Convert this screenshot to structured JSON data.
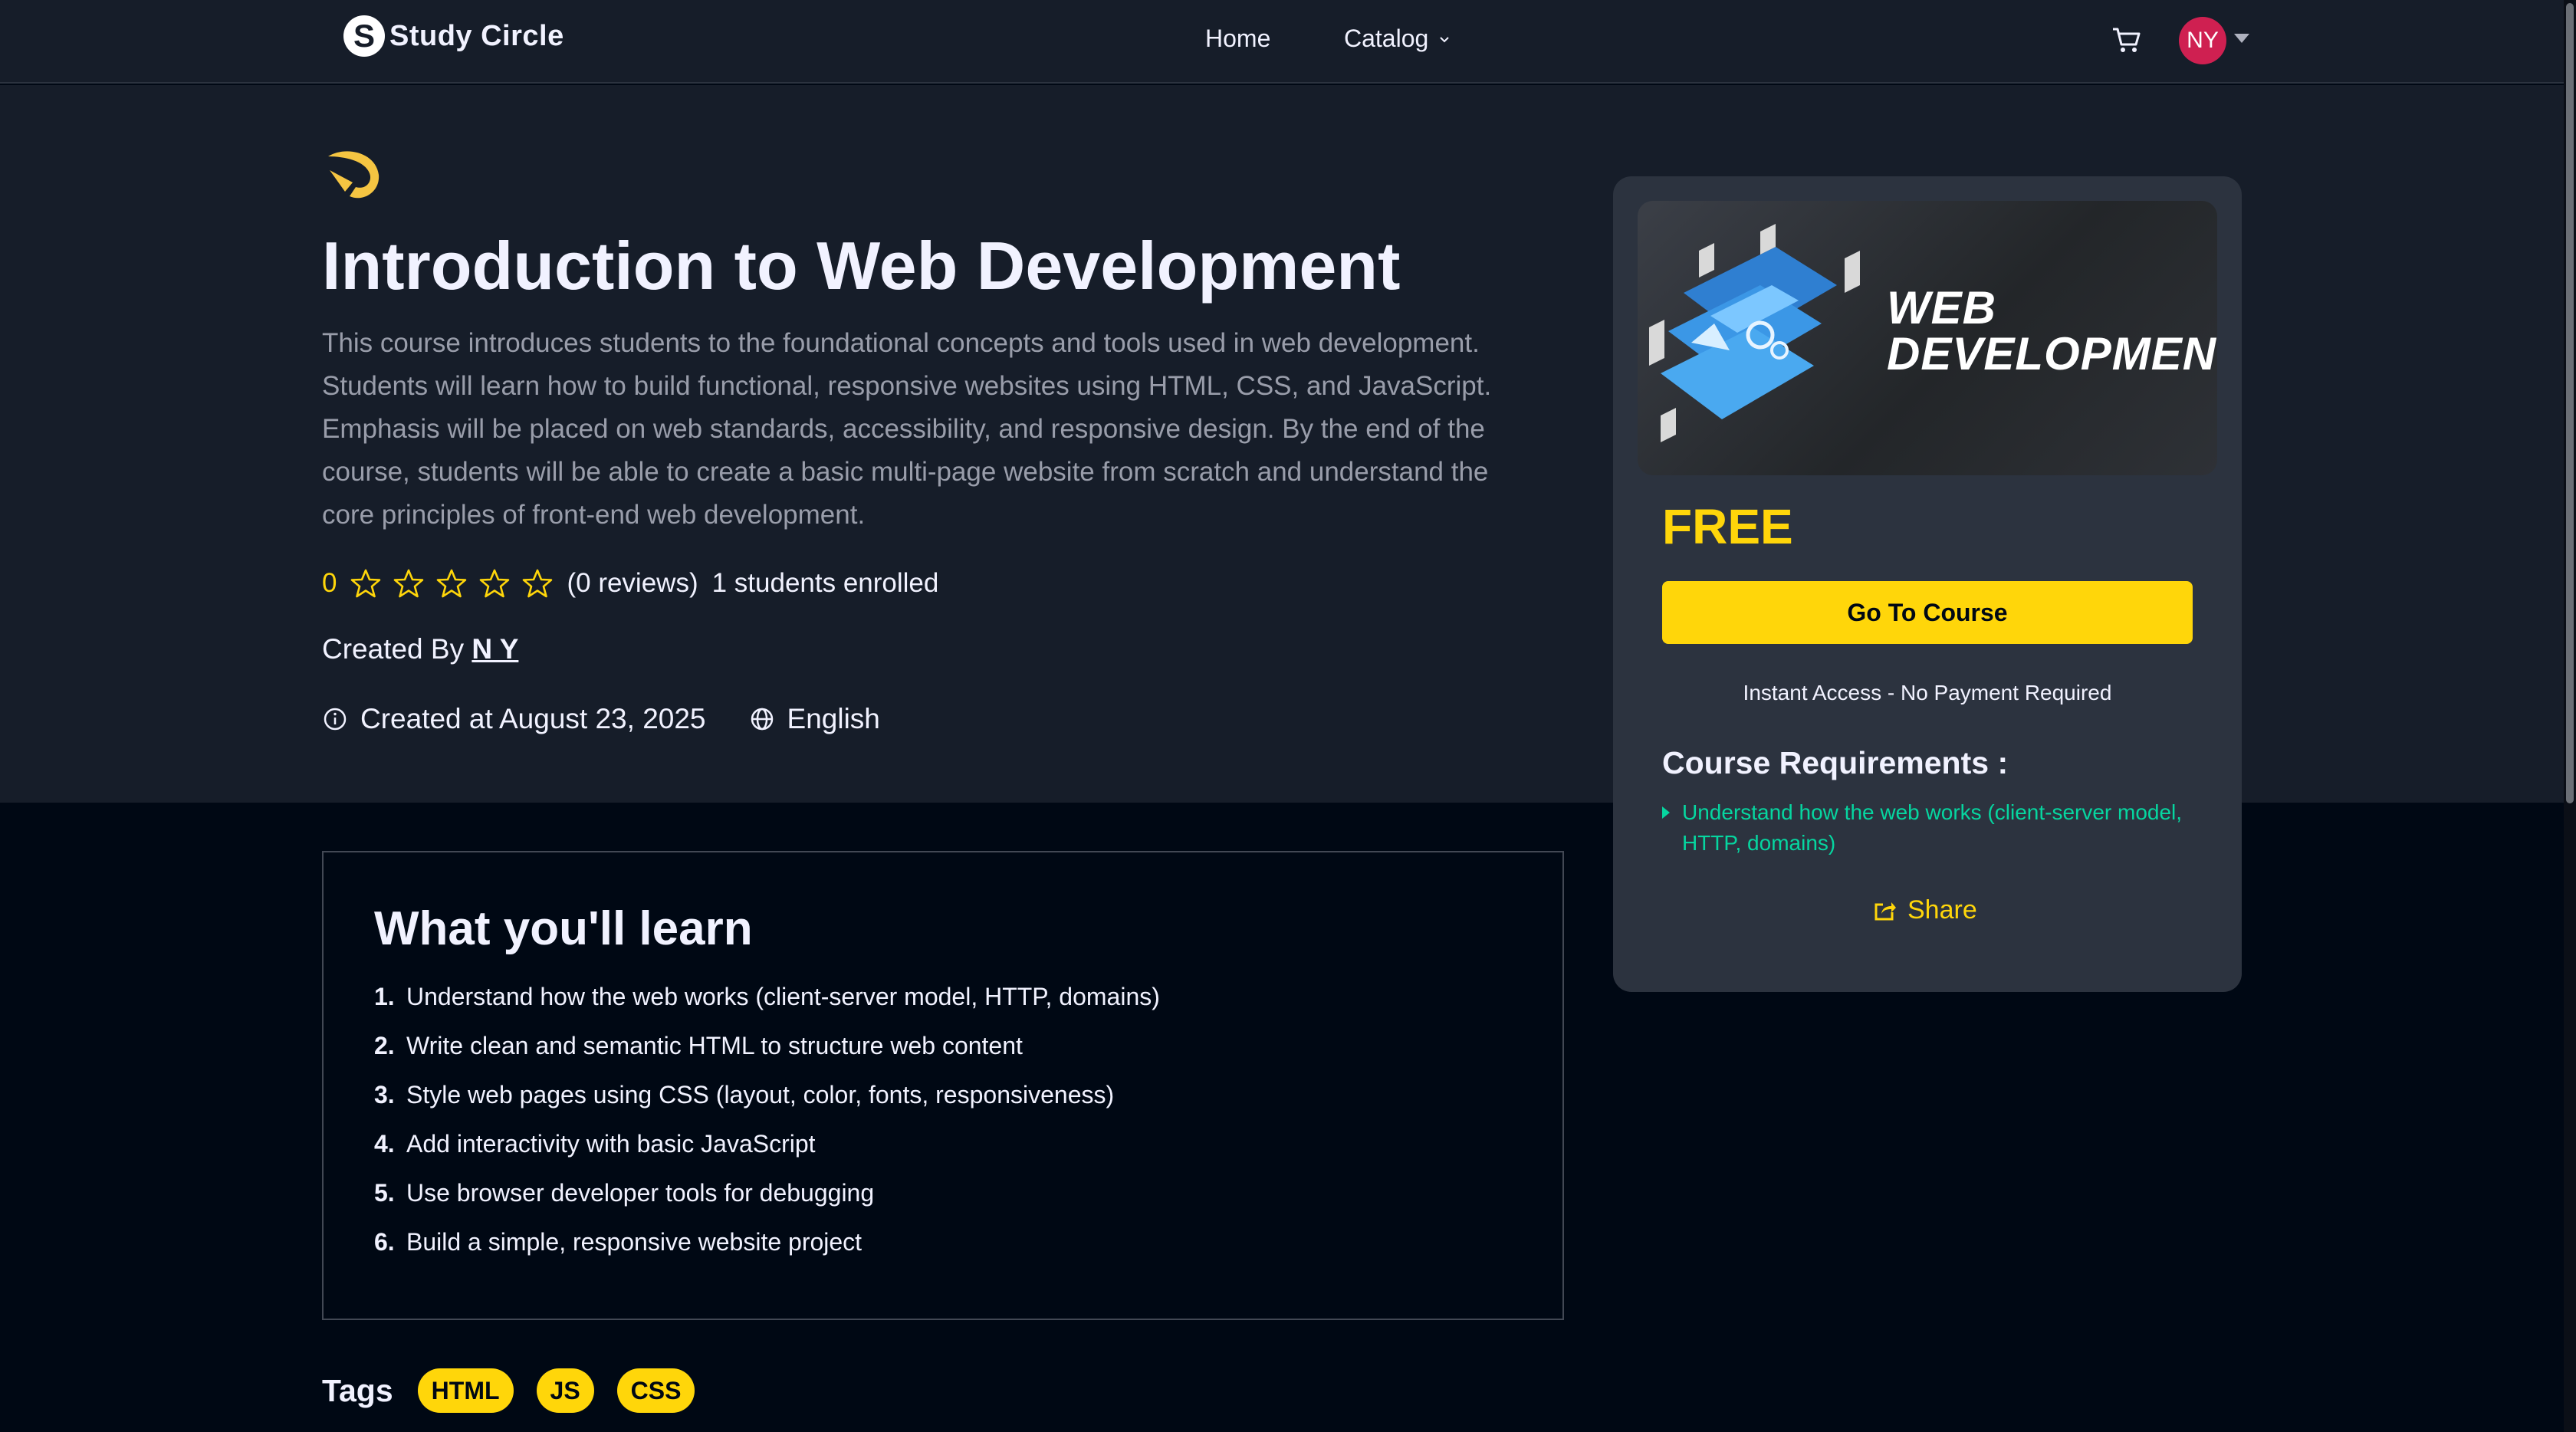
{
  "nav": {
    "brand": "Study Circle",
    "brand_letter": "S",
    "links": [
      {
        "label": "Home"
      },
      {
        "label": "Catalog"
      }
    ],
    "avatar_initials": "NY"
  },
  "course": {
    "title": "Introduction to Web Development",
    "description": "This course introduces students to the foundational concepts and tools used in web development. Students will learn how to build functional, responsive websites using HTML, CSS, and JavaScript. Emphasis will be placed on web standards, accessibility, and responsive design. By the end of the course, students will be able to create a basic multi-page website from scratch and understand the core principles of front-end web development.",
    "rating": "0",
    "stars_filled": 0,
    "stars_total": 5,
    "reviews": "(0 reviews)",
    "enrolled": "1 students enrolled",
    "created_by_prefix": "Created By",
    "instructor": "N Y",
    "created_at": "Created at August 23, 2025",
    "language": "English"
  },
  "card": {
    "thumbnail_line1": "WEB",
    "thumbnail_line2": "DEVELOPMENT",
    "price": "FREE",
    "cta_label": "Go To Course",
    "access_note": "Instant Access - No Payment Required",
    "requirements_title": "Course Requirements :",
    "requirements": [
      "Understand how the web works (client-server model, HTTP, domains)"
    ],
    "share_label": "Share"
  },
  "learn": {
    "title": "What you'll learn",
    "items": [
      {
        "num": "1.",
        "text": "Understand how the web works (client-server model, HTTP, domains)"
      },
      {
        "num": "2.",
        "text": "Write clean and semantic HTML to structure web content"
      },
      {
        "num": "3.",
        "text": "Style web pages using CSS (layout, color, fonts, responsiveness)"
      },
      {
        "num": "4.",
        "text": "Add interactivity with basic JavaScript"
      },
      {
        "num": "5.",
        "text": "Use browser developer tools for debugging"
      },
      {
        "num": "6.",
        "text": "Build a simple, responsive website project"
      }
    ]
  },
  "tags": {
    "label": "Tags",
    "items": [
      "HTML",
      "JS",
      "CSS"
    ]
  },
  "colors": {
    "nav_bg": "#161d29",
    "page_bg": "#000814",
    "accent_yellow": "#ffd60a",
    "requirement_green": "#06d6a0",
    "avatar_bg": "#cf2051",
    "card_bg": "#2c333f"
  },
  "icons": {
    "cart": "cart-icon",
    "star": "star-outline-icon",
    "info": "info-icon",
    "globe": "globe-icon",
    "share": "share-icon",
    "chevron": "chevron-down-icon"
  }
}
